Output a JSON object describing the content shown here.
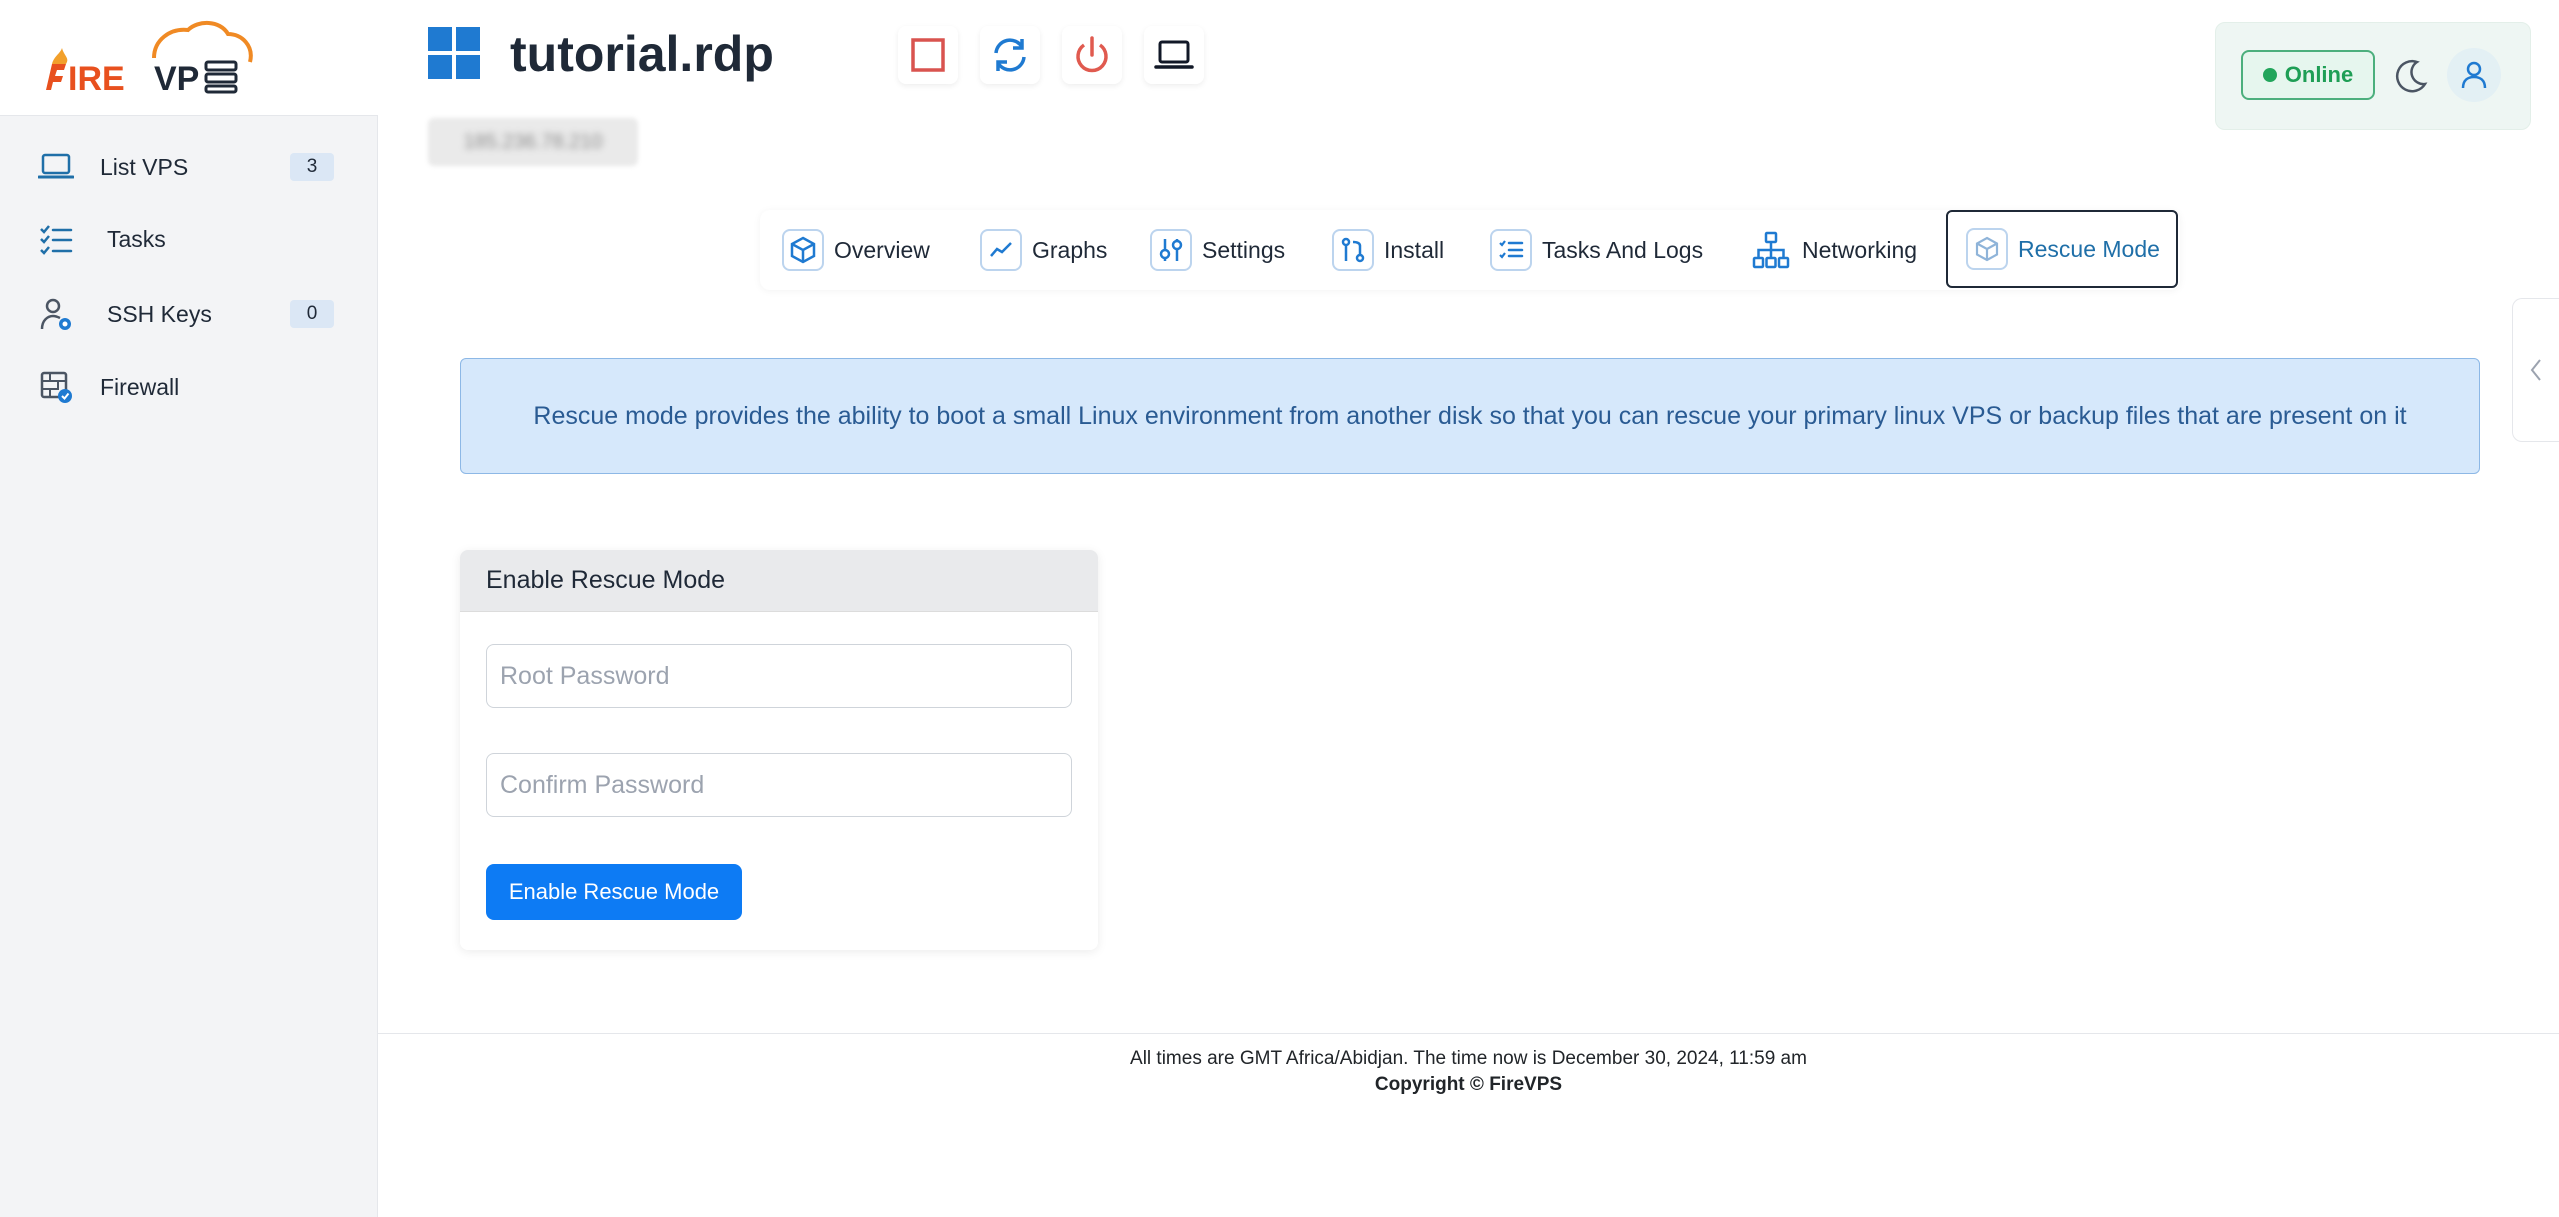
{
  "app": {
    "logo_text": "FIRE VPS"
  },
  "sidebar": {
    "items": [
      {
        "label": "List VPS",
        "badge": "3",
        "icon": "laptop-icon"
      },
      {
        "label": "Tasks",
        "icon": "checklist-icon"
      },
      {
        "label": "SSH Keys",
        "badge": "0",
        "icon": "user-key-icon"
      },
      {
        "label": "Firewall",
        "icon": "firewall-icon"
      }
    ]
  },
  "header": {
    "title": "tutorial.rdp",
    "ip_address": "185.236.78.210",
    "controls": [
      "stop-icon",
      "restart-icon",
      "power-icon",
      "console-icon"
    ],
    "status": "Online",
    "colors": {
      "status_green": "#1e9e55",
      "stop_red": "#d9534f",
      "restart_blue": "#1f7ad1",
      "power_red": "#e05a4f"
    }
  },
  "tabs": [
    {
      "label": "Overview",
      "icon": "cube-icon"
    },
    {
      "label": "Graphs",
      "icon": "graph-icon"
    },
    {
      "label": "Settings",
      "icon": "sliders-icon"
    },
    {
      "label": "Install",
      "icon": "git-icon"
    },
    {
      "label": "Tasks And Logs",
      "icon": "list-icon"
    },
    {
      "label": "Networking",
      "icon": "network-icon"
    },
    {
      "label": "Rescue Mode",
      "icon": "rescue-cube-icon",
      "active": true
    }
  ],
  "alert": {
    "text": "Rescue mode provides the ability to boot a small Linux environment from another disk so that you can rescue your primary linux VPS or backup files that are present on it"
  },
  "rescue_card": {
    "title": "Enable Rescue Mode",
    "root_password_placeholder": "Root Password",
    "confirm_password_placeholder": "Confirm Password",
    "button_label": "Enable Rescue Mode",
    "accent": "#0d7bf4"
  },
  "footer": {
    "time_text": "All times are GMT Africa/Abidjan. The time now is December 30, 2024, 11:59 am",
    "copyright": "Copyright © FireVPS"
  }
}
